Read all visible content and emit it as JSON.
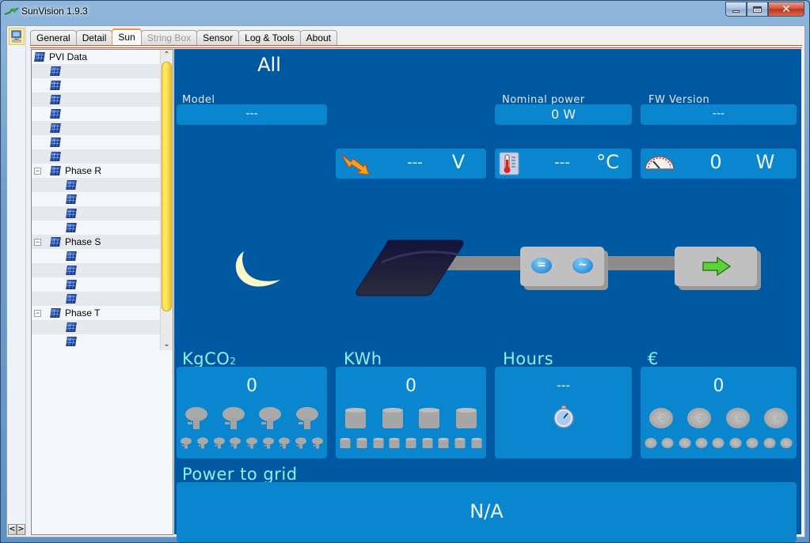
{
  "window": {
    "title": "SunVision 1.9.3",
    "controls": {
      "minimize": "minimize",
      "maximize": "maximize",
      "close": "close"
    }
  },
  "tabs": [
    {
      "label": "General",
      "state": "normal"
    },
    {
      "label": "Detail",
      "state": "normal"
    },
    {
      "label": "Sun",
      "state": "active"
    },
    {
      "label": "String Box",
      "state": "disabled"
    },
    {
      "label": "Sensor",
      "state": "normal"
    },
    {
      "label": "Log & Tools",
      "state": "normal"
    },
    {
      "label": "About",
      "state": "normal"
    }
  ],
  "tree": {
    "root": "PVI Data",
    "root_children_count": 7,
    "groups": [
      {
        "label": "Phase R",
        "expanded": true,
        "children_count": 4
      },
      {
        "label": "Phase S",
        "expanded": true,
        "children_count": 4
      },
      {
        "label": "Phase T",
        "expanded": true,
        "children_count": 2
      }
    ],
    "toggle_glyph": "−"
  },
  "nav": {
    "prev": "<",
    "next": ">"
  },
  "sun": {
    "selection": "All",
    "model": {
      "label": "Model",
      "value": "---"
    },
    "nominal_power": {
      "label": "Nominal power",
      "value": "0 W"
    },
    "fw_version": {
      "label": "FW Version",
      "value": "---"
    },
    "voltage": {
      "icon": "lightning-icon",
      "value": "---",
      "unit": "V"
    },
    "temperature": {
      "icon": "thermometer-icon",
      "value": "---",
      "unit": "°C"
    },
    "power": {
      "icon": "gauge-icon",
      "value": "0",
      "unit": "W"
    },
    "status": {
      "time_of_day": "night",
      "icon": "moon-icon"
    },
    "flow": {
      "panel": "solar-panel-icon",
      "inverter_dc": "=",
      "inverter_ac": "~",
      "grid": "arrow-right-icon"
    },
    "kgco2": {
      "label": "KgCO",
      "subscript": "2",
      "value": "0",
      "large_icons": 4,
      "small_icons": 9
    },
    "kwh": {
      "label": "KWh",
      "value": "0",
      "large_icons": 4,
      "small_icons": 9
    },
    "hours": {
      "label": "Hours",
      "value": "---"
    },
    "euro": {
      "label": "€",
      "value": "0",
      "large_icons": 4,
      "small_icons": 9,
      "coin_glyph": "€"
    },
    "power_to_grid": {
      "label": "Power to grid",
      "value": "N/A"
    }
  },
  "colors": {
    "panel_bg": "#0058a0",
    "box_bg": "#0a86cf",
    "caption_cyan": "#8ef0f5",
    "active_tab_border": "#e09a4b",
    "scroll_thumb": "#f9e04a"
  }
}
